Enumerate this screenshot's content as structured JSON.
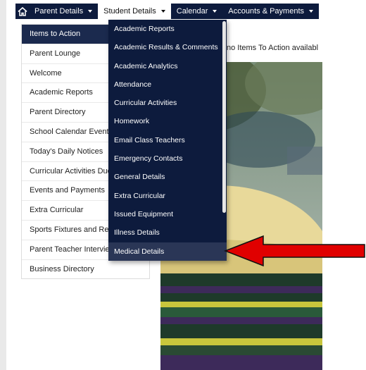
{
  "navbar": {
    "items": [
      {
        "label": "Parent Details"
      },
      {
        "label": "Student Details"
      },
      {
        "label": "Calendar"
      },
      {
        "label": "Accounts & Payments"
      }
    ]
  },
  "sidebar": {
    "items": [
      {
        "label": "Items to Action"
      },
      {
        "label": "Parent Lounge"
      },
      {
        "label": "Welcome"
      },
      {
        "label": "Academic Reports"
      },
      {
        "label": "Parent Directory"
      },
      {
        "label": "School Calendar Events"
      },
      {
        "label": "Today's Daily Notices"
      },
      {
        "label": "Curricular Activities Due"
      },
      {
        "label": "Events and Payments"
      },
      {
        "label": "Extra Curricular"
      },
      {
        "label": "Sports Fixtures and Res"
      },
      {
        "label": "Parent Teacher Interview"
      },
      {
        "label": "Business Directory"
      }
    ]
  },
  "main": {
    "notice": "no Items To Action availabl"
  },
  "dropdown": {
    "items": [
      {
        "label": "Academic Reports"
      },
      {
        "label": "Academic Results & Comments"
      },
      {
        "label": "Academic Analytics"
      },
      {
        "label": "Attendance"
      },
      {
        "label": "Curricular Activities"
      },
      {
        "label": "Homework"
      },
      {
        "label": "Email Class Teachers"
      },
      {
        "label": "Emergency Contacts"
      },
      {
        "label": "General Details"
      },
      {
        "label": "Extra Curricular"
      },
      {
        "label": "Issued Equipment"
      },
      {
        "label": "Illness Details"
      },
      {
        "label": "Medical Details"
      }
    ]
  },
  "colors": {
    "nav_bg": "#0d1b3d",
    "active_item_bg": "#1b2a4e",
    "arrow": "#e00000"
  }
}
